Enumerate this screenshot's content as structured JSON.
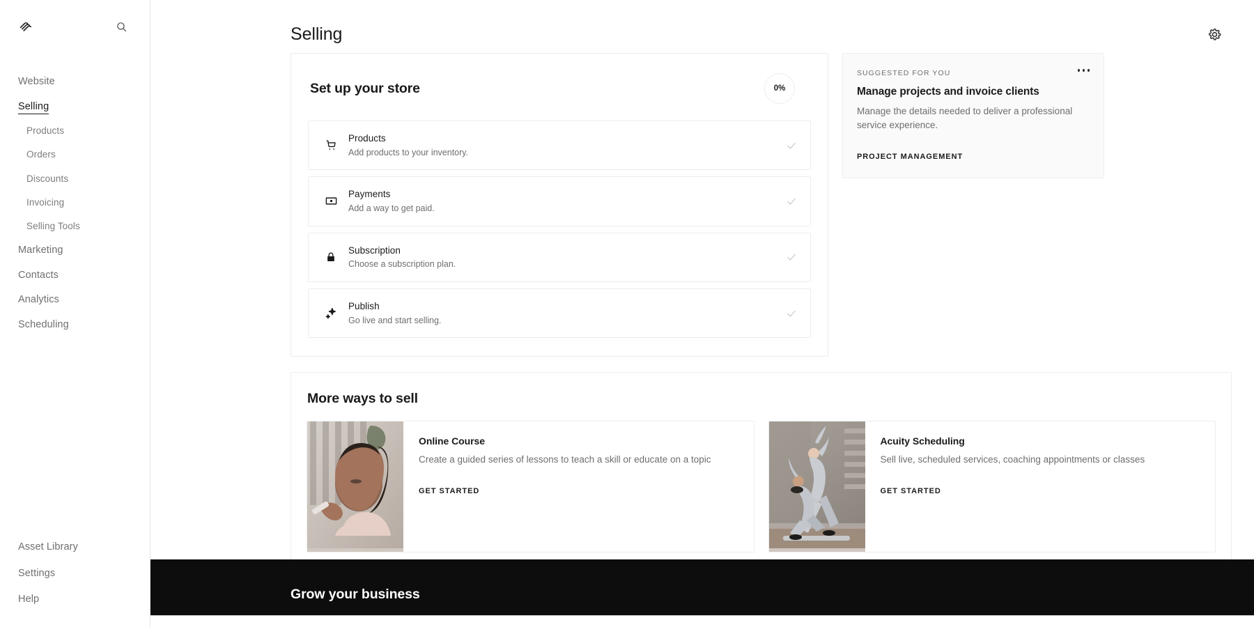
{
  "sidebar": {
    "logo_icon": "squarespace-logo",
    "search_icon": "search-icon",
    "primary_items": [
      {
        "label": "Website",
        "active": false
      },
      {
        "label": "Selling",
        "active": true
      }
    ],
    "sub_items": [
      {
        "label": "Products"
      },
      {
        "label": "Orders"
      },
      {
        "label": "Discounts"
      },
      {
        "label": "Invoicing"
      },
      {
        "label": "Selling Tools"
      }
    ],
    "secondary_items": [
      {
        "label": "Marketing"
      },
      {
        "label": "Contacts"
      },
      {
        "label": "Analytics"
      },
      {
        "label": "Scheduling"
      }
    ],
    "bottom_items": [
      {
        "label": "Asset Library"
      },
      {
        "label": "Settings"
      },
      {
        "label": "Help"
      }
    ]
  },
  "header": {
    "title": "Selling",
    "settings_icon": "gear-icon"
  },
  "setup": {
    "title": "Set up your store",
    "progress_label": "0%",
    "progress_value": 0,
    "items": [
      {
        "icon": "shopping-cart-icon",
        "title": "Products",
        "subtitle": "Add products to your inventory.",
        "check_icon": "check-icon"
      },
      {
        "icon": "payment-card-icon",
        "title": "Payments",
        "subtitle": "Add a way to get paid.",
        "check_icon": "check-icon"
      },
      {
        "icon": "lock-icon",
        "title": "Subscription",
        "subtitle": "Choose a subscription plan.",
        "check_icon": "check-icon"
      },
      {
        "icon": "sparkle-icon",
        "title": "Publish",
        "subtitle": "Go live and start selling.",
        "check_icon": "check-icon"
      }
    ]
  },
  "suggested": {
    "eyebrow": "SUGGESTED FOR YOU",
    "menu_icon": "more-options-icon",
    "title": "Manage projects and invoice clients",
    "description": "Manage the details needed to deliver a professional service experience.",
    "cta": "PROJECT MANAGEMENT"
  },
  "more_ways": {
    "title": "More ways to sell",
    "cards": [
      {
        "title": "Online Course",
        "description": "Create a guided series of lessons to teach a skill or educate on a topic",
        "cta": "GET STARTED",
        "thumb_alt": "woman applying makeup"
      },
      {
        "title": "Acuity Scheduling",
        "description": "Sell live, scheduled services, coaching appointments or classes",
        "cta": "GET STARTED",
        "thumb_alt": "two women stretching outdoors"
      }
    ]
  },
  "grow": {
    "title": "Grow your business"
  },
  "colors": {
    "text_primary": "#1a1a1a",
    "text_muted": "#6e6e6e",
    "border": "#ededed",
    "banner_bg": "#0d0d0d",
    "check_gray": "#cfcfcf"
  }
}
